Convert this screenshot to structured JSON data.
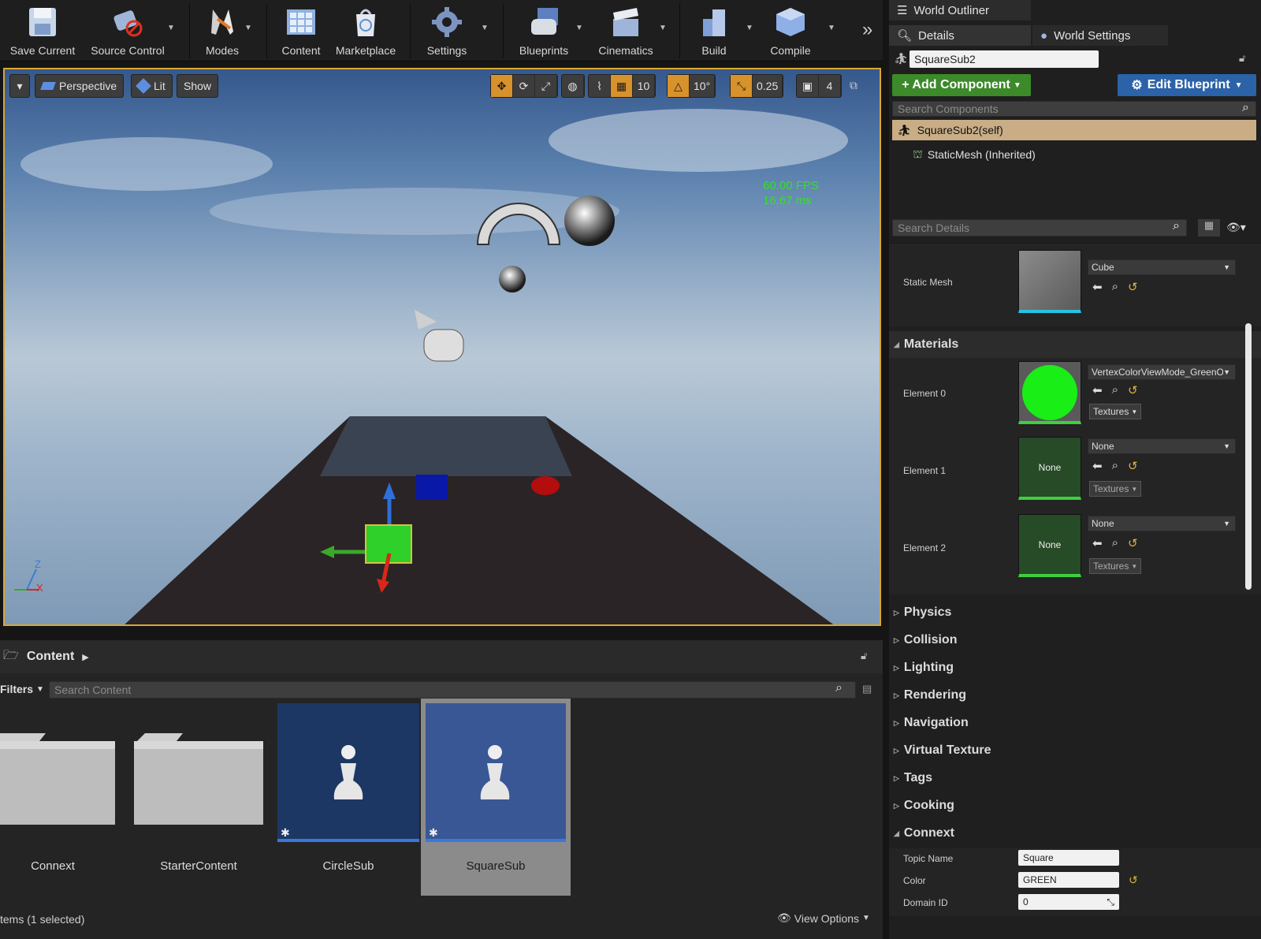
{
  "toolbar": {
    "buttons": [
      {
        "label": "Save Current",
        "icon": "save-icon"
      },
      {
        "label": "Source Control",
        "icon": "source-control-icon"
      },
      {
        "label": "Modes",
        "icon": "modes-icon"
      },
      {
        "label": "Content",
        "icon": "content-icon"
      },
      {
        "label": "Marketplace",
        "icon": "marketplace-icon"
      },
      {
        "label": "Settings",
        "icon": "settings-icon"
      },
      {
        "label": "Blueprints",
        "icon": "blueprints-icon"
      },
      {
        "label": "Cinematics",
        "icon": "cinematics-icon"
      },
      {
        "label": "Build",
        "icon": "build-icon"
      },
      {
        "label": "Compile",
        "icon": "compile-icon"
      }
    ],
    "more_icon": "chevron-double-right-icon"
  },
  "viewport": {
    "perspective_label": "Perspective",
    "lit_label": "Lit",
    "show_label": "Show",
    "grid_snap": "10",
    "rotation_snap": "10°",
    "scale_snap": "0.25",
    "camera_speed": "4",
    "fps": "60.00 FPS",
    "ms": "16.67 ms",
    "axis_z": "Z",
    "axis_x": "X"
  },
  "outliner": {
    "tab_label": "World Outliner"
  },
  "details": {
    "tab_label": "Details",
    "world_settings_label": "World Settings",
    "actor_name": "SquareSub2",
    "add_component_label": "+ Add Component",
    "edit_blueprint_label": "Edit Blueprint",
    "search_components_placeholder": "Search Components",
    "self_component": "SquareSub2(self)",
    "child_component": "StaticMesh (Inherited)",
    "search_details_placeholder": "Search Details",
    "static_mesh": {
      "label": "Static Mesh",
      "value": "Cube"
    },
    "materials": {
      "title": "Materials",
      "elements": [
        {
          "label": "Element 0",
          "value": "VertexColorViewMode_GreenOı",
          "textures": "Textures",
          "thumb": ""
        },
        {
          "label": "Element 1",
          "value": "None",
          "textures": "Textures",
          "thumb": "None"
        },
        {
          "label": "Element 2",
          "value": "None",
          "textures": "Textures",
          "thumb": "None"
        }
      ]
    },
    "categories": [
      "Physics",
      "Collision",
      "Lighting",
      "Rendering",
      "Navigation",
      "Virtual Texture",
      "Tags",
      "Cooking"
    ],
    "connext": {
      "title": "Connext",
      "topic_name_label": "Topic Name",
      "topic_name": "Square",
      "color_label": "Color",
      "color": "GREEN",
      "domain_id_label": "Domain ID",
      "domain_id": "0"
    }
  },
  "content_browser": {
    "title": "Content",
    "filters_label": "Filters",
    "search_placeholder": "Search Content",
    "assets": [
      {
        "name": "Connext",
        "kind": "folder"
      },
      {
        "name": "StarterContent",
        "kind": "folder"
      },
      {
        "name": "CircleSub",
        "kind": "blueprint"
      },
      {
        "name": "SquareSub",
        "kind": "blueprint",
        "selected": true
      }
    ],
    "status": "tems (1 selected)",
    "view_options_label": "View Options"
  },
  "colors": {
    "accent": "#d8a830",
    "blueprint_btn": "#2b62a8",
    "add_component_btn": "#3c8a2a",
    "fps_green": "#33e02a",
    "selected_row": "#c9ad85"
  }
}
